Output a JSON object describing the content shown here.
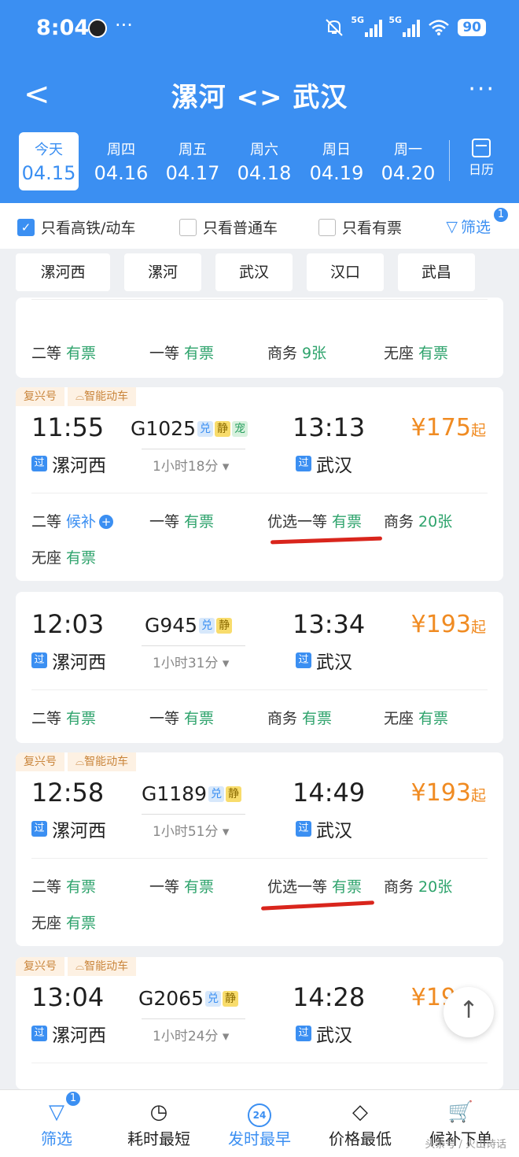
{
  "status": {
    "time": "8:04",
    "dots": "···",
    "net1": "5G",
    "net2": "5G",
    "battery": "90"
  },
  "nav": {
    "back": "<",
    "title": "漯河 <> 武汉",
    "more": "···"
  },
  "dates": [
    {
      "weekday": "今天",
      "date": "04.15"
    },
    {
      "weekday": "周四",
      "date": "04.16"
    },
    {
      "weekday": "周五",
      "date": "04.17"
    },
    {
      "weekday": "周六",
      "date": "04.18"
    },
    {
      "weekday": "周日",
      "date": "04.19"
    },
    {
      "weekday": "周一",
      "date": "04.20"
    }
  ],
  "calendar_label": "日历",
  "filters": {
    "high_speed": "只看高铁/动车",
    "normal": "只看普通车",
    "available": "只看有票",
    "filter_label": "筛选",
    "filter_badge": "1"
  },
  "stations": [
    "漯河西",
    "漯河",
    "武汉",
    "汉口",
    "武昌"
  ],
  "partial_card": {
    "seats": [
      {
        "label": "二等",
        "status": "有票"
      },
      {
        "label": "一等",
        "status": "有票"
      },
      {
        "label": "商务",
        "status": "9张"
      },
      {
        "label": "无座",
        "status": "有票"
      }
    ]
  },
  "trains": [
    {
      "tags": [
        "复兴号",
        "智能动车"
      ],
      "dep": "11:55",
      "arr": "13:13",
      "no": "G1025",
      "marks": [
        "兑",
        "静",
        "宠"
      ],
      "from": "漯河西",
      "to": "武汉",
      "pass": "过",
      "duration": "1小时18分",
      "price": "¥175",
      "price_suffix": "起",
      "seats": [
        {
          "label": "二等",
          "status": "候补"
        },
        {
          "label": "一等",
          "status": "有票"
        },
        {
          "label": "优选一等",
          "status": "有票"
        },
        {
          "label": "商务",
          "status": "20张"
        },
        {
          "label": "无座",
          "status": "有票"
        }
      ]
    },
    {
      "tags": [],
      "dep": "12:03",
      "arr": "13:34",
      "no": "G945",
      "marks": [
        "兑",
        "静"
      ],
      "from": "漯河西",
      "to": "武汉",
      "pass": "过",
      "duration": "1小时31分",
      "price": "¥193",
      "price_suffix": "起",
      "seats": [
        {
          "label": "二等",
          "status": "有票"
        },
        {
          "label": "一等",
          "status": "有票"
        },
        {
          "label": "商务",
          "status": "有票"
        },
        {
          "label": "无座",
          "status": "有票"
        }
      ]
    },
    {
      "tags": [
        "复兴号",
        "智能动车"
      ],
      "dep": "12:58",
      "arr": "14:49",
      "no": "G1189",
      "marks": [
        "兑",
        "静"
      ],
      "from": "漯河西",
      "to": "武汉",
      "pass": "过",
      "duration": "1小时51分",
      "price": "¥193",
      "price_suffix": "起",
      "seats": [
        {
          "label": "二等",
          "status": "有票"
        },
        {
          "label": "一等",
          "status": "有票"
        },
        {
          "label": "优选一等",
          "status": "有票"
        },
        {
          "label": "商务",
          "status": "20张"
        },
        {
          "label": "无座",
          "status": "有票"
        }
      ]
    },
    {
      "tags": [
        "复兴号",
        "智能动车"
      ],
      "dep": "13:04",
      "arr": "14:28",
      "no": "G2065",
      "marks": [
        "兑",
        "静"
      ],
      "from": "漯河西",
      "to": "武汉",
      "pass": "过",
      "duration": "1小时24分",
      "price": "¥19",
      "seats": []
    }
  ],
  "back_to_top": "↑",
  "bottom_nav": [
    {
      "label": "筛选",
      "badge": "1"
    },
    {
      "label": "耗时最短"
    },
    {
      "label": "发时最早",
      "icon_text": "24"
    },
    {
      "label": "价格最低"
    },
    {
      "label": "候补下单"
    }
  ],
  "watermark": "头条号 / 火山诗话",
  "colors": {
    "primary": "#3b8ff2",
    "available": "#2ea36c",
    "price": "#f08b22",
    "annotation": "#d9251c"
  }
}
